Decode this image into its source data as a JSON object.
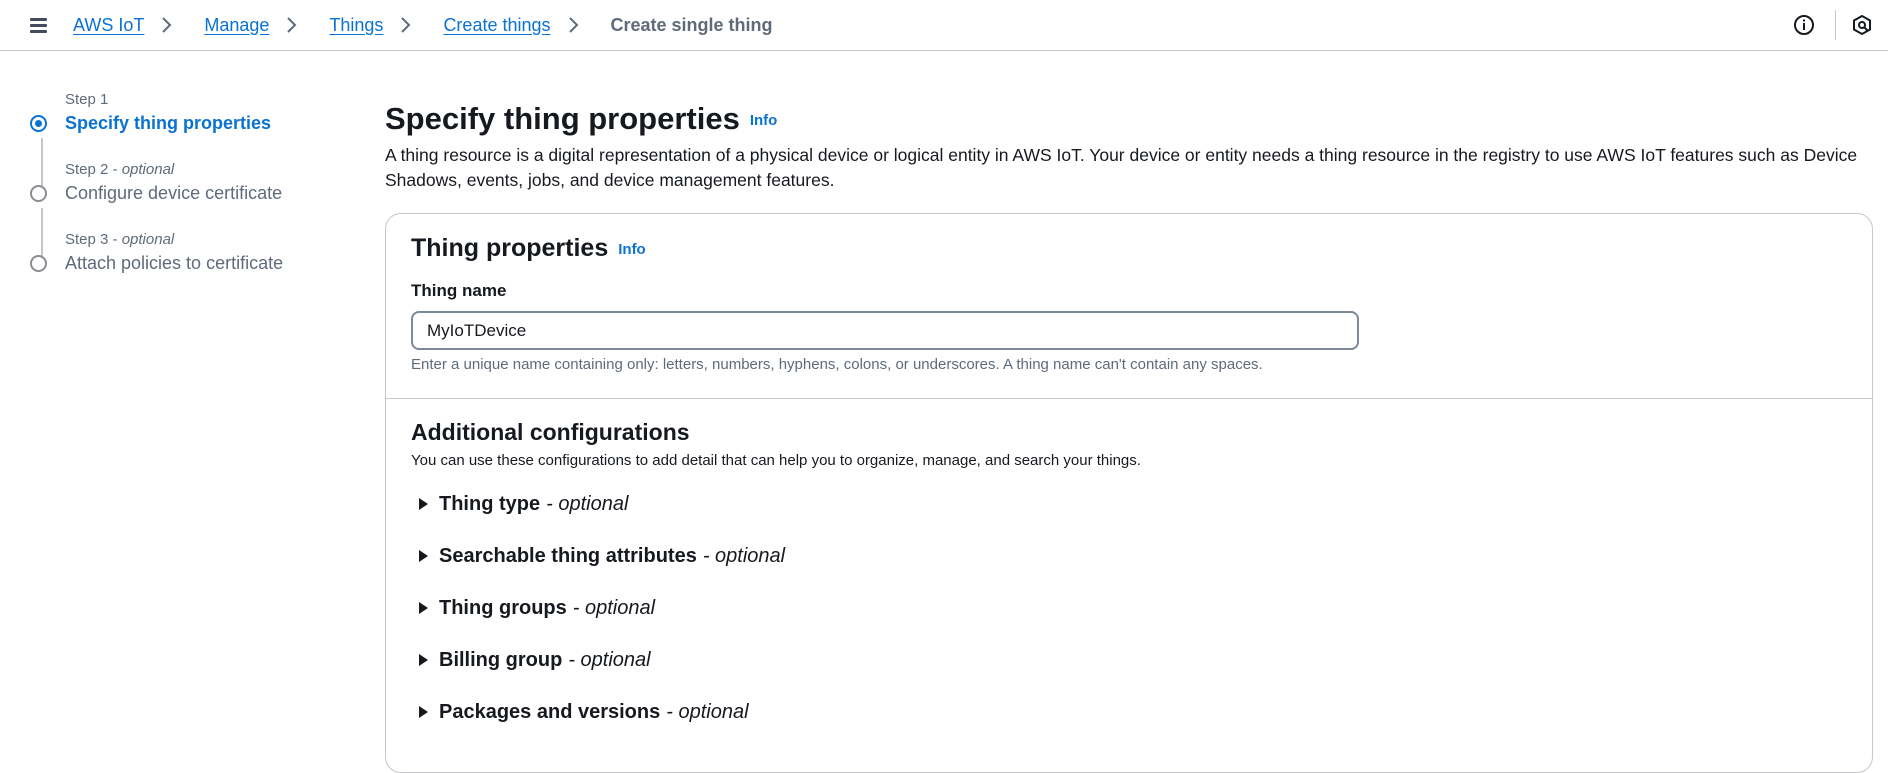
{
  "breadcrumb": {
    "items": [
      "AWS IoT",
      "Manage",
      "Things",
      "Create things"
    ],
    "current": "Create single thing"
  },
  "icons": {
    "menu": "hamburger-menu-icon",
    "separator": "chevron-right-icon",
    "info": "info-circle-icon",
    "settings": "settings-hexagon-icon",
    "caret": "caret-right-icon"
  },
  "steps": [
    {
      "num": "Step 1",
      "optional": "",
      "title": "Specify thing properties",
      "state": "active"
    },
    {
      "num": "Step 2 - ",
      "optional": "optional",
      "title": "Configure device certificate",
      "state": "inactive"
    },
    {
      "num": "Step 3 - ",
      "optional": "optional",
      "title": "Attach policies to certificate",
      "state": "inactive"
    }
  ],
  "page": {
    "title": "Specify thing properties",
    "info": "Info",
    "description": "A thing resource is a digital representation of a physical device or logical entity in AWS IoT. Your device or entity needs a thing resource in the registry to use AWS IoT features such as Device Shadows, events, jobs, and device management features."
  },
  "thing_properties": {
    "title": "Thing properties",
    "info": "Info",
    "name_label": "Thing name",
    "name_value": "MyIoTDevice",
    "hint": "Enter a unique name containing only: letters, numbers, hyphens, colons, or underscores. A thing name can't contain any spaces."
  },
  "additional": {
    "title": "Additional configurations",
    "description": "You can use these configurations to add detail that can help you to organize, manage, and search your things.",
    "sections": [
      {
        "title": "Thing type",
        "optional": "- optional"
      },
      {
        "title": "Searchable thing attributes",
        "optional": "- optional"
      },
      {
        "title": "Thing groups",
        "optional": "- optional"
      },
      {
        "title": "Billing group",
        "optional": "- optional"
      },
      {
        "title": "Packages and versions",
        "optional": "- optional"
      }
    ]
  },
  "colors": {
    "link": "#0972d3",
    "text": "#16191f",
    "muted": "#5f6b7a",
    "border": "#c6c6cd"
  }
}
